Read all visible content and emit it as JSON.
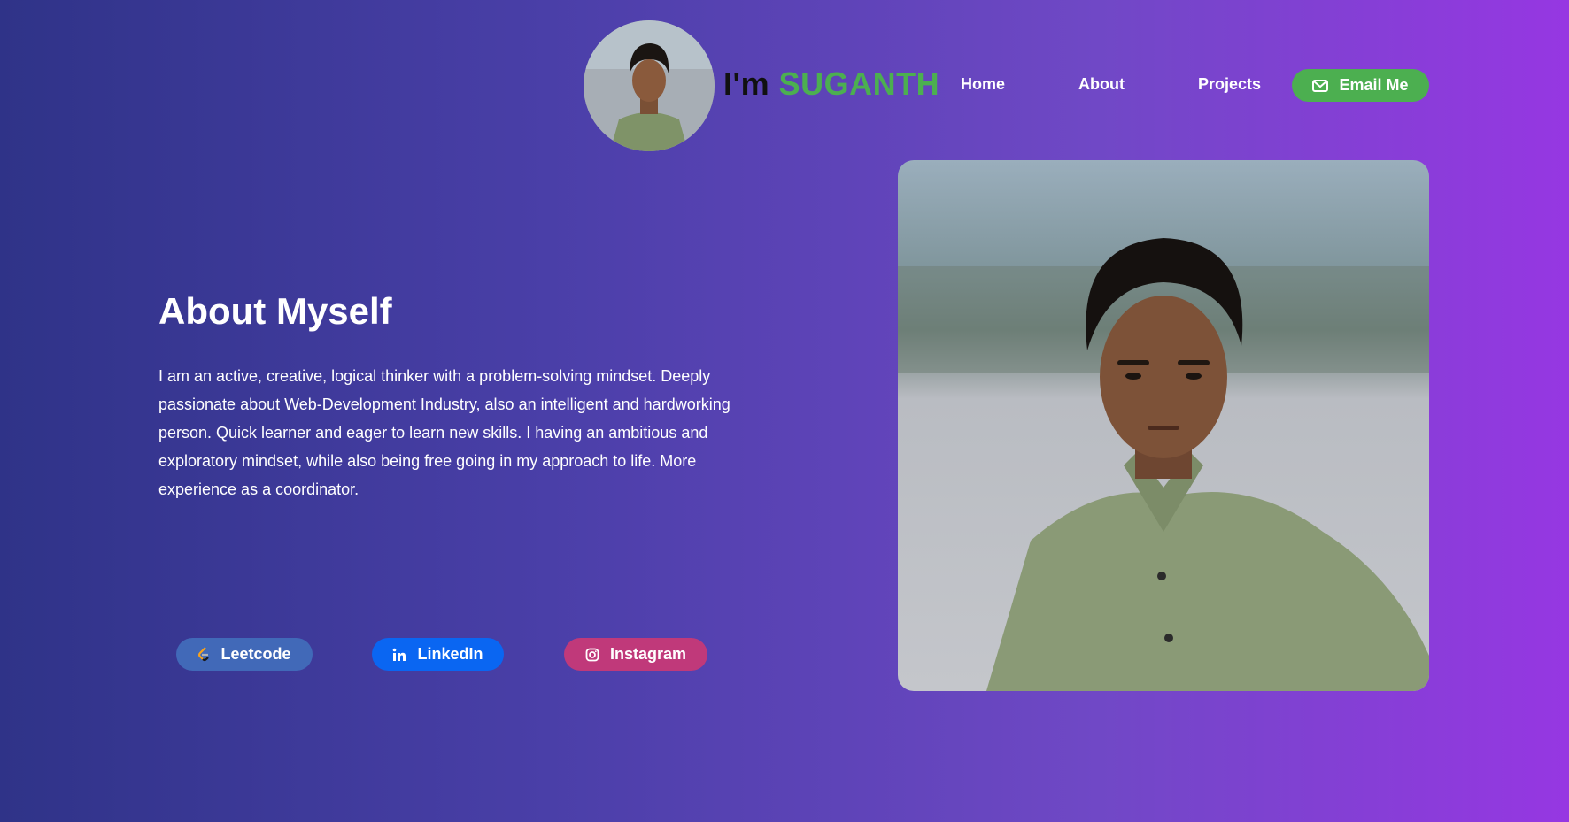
{
  "header": {
    "brand_prefix": "I'm",
    "brand_name": "SUGANTH",
    "nav": {
      "home": "Home",
      "about": "About",
      "projects": "Projects"
    },
    "email_button": "Email Me"
  },
  "about": {
    "title": "About Myself",
    "description": "I am an active, creative, logical thinker with a problem-solving mindset. Deeply passionate about Web-Development Industry, also an intelligent and hardworking person. Quick learner and eager to learn new skills. I having an ambitious and exploratory mindset, while also being free going in my approach to life. More experience as a coordinator."
  },
  "social": {
    "leetcode": "Leetcode",
    "linkedin": "LinkedIn",
    "instagram": "Instagram"
  },
  "colors": {
    "accent_green": "#4caf50",
    "leetcode_blue": "#4169b8",
    "linkedin_blue": "#0a66f2",
    "instagram_pink": "#c0397a"
  },
  "icons": [
    "envelope-icon",
    "leetcode-icon",
    "linkedin-icon",
    "instagram-icon"
  ]
}
